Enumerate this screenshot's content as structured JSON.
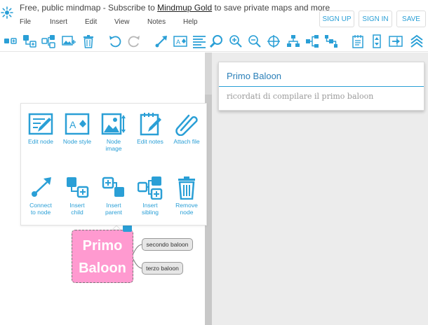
{
  "banner": {
    "prefix": "Free, public mindmap - Subscribe to ",
    "link": "Mindmup Gold",
    "suffix": " to save private maps and more"
  },
  "menu": [
    "File",
    "Insert",
    "Edit",
    "View",
    "Notes",
    "Help"
  ],
  "auth": {
    "sign_up": "SIGN UP",
    "sign_in": "SIGN IN",
    "save": "SAVE"
  },
  "toolbar_icons": [
    "add-child-icon",
    "add-sibling-icon",
    "add-parent-icon",
    "add-image-icon",
    "delete-icon",
    "undo-icon",
    "redo-icon",
    "connect-icon",
    "node-style-icon",
    "text-align-icon",
    "search-icon",
    "zoom-in-icon",
    "zoom-out-icon",
    "reset-view-icon",
    "layout-top-down-icon",
    "layout-horizontal-icon",
    "layout-left-right-icon",
    "notes-icon",
    "column-icon",
    "export-icon",
    "collapse-icon"
  ],
  "context_menu": [
    {
      "label": "Edit node",
      "icon": "edit-node-icon"
    },
    {
      "label": "Node style",
      "icon": "node-style-icon"
    },
    {
      "label": "Node\nimage",
      "icon": "node-image-icon"
    },
    {
      "label": "Edit notes",
      "icon": "edit-notes-icon"
    },
    {
      "label": "Attach file",
      "icon": "attach-file-icon"
    },
    {
      "label": "Connect\nto node",
      "icon": "connect-node-icon"
    },
    {
      "label": "Insert\nchild",
      "icon": "insert-child-icon"
    },
    {
      "label": "Insert\nparent",
      "icon": "insert-parent-icon"
    },
    {
      "label": "Insert\nsibling",
      "icon": "insert-sibling-icon"
    },
    {
      "label": "Remove\nnode",
      "icon": "remove-node-icon"
    }
  ],
  "map": {
    "root": "Primo\nBaloon",
    "children": [
      "secondo baloon",
      "terzo baloon"
    ]
  },
  "notes": {
    "title": "Primo Baloon",
    "body": "ricordati di compilare il primo baloon"
  },
  "colors": {
    "accent": "#2a9fd6",
    "root_fill": "#ff9ad0",
    "panel_bg": "#ececec"
  }
}
